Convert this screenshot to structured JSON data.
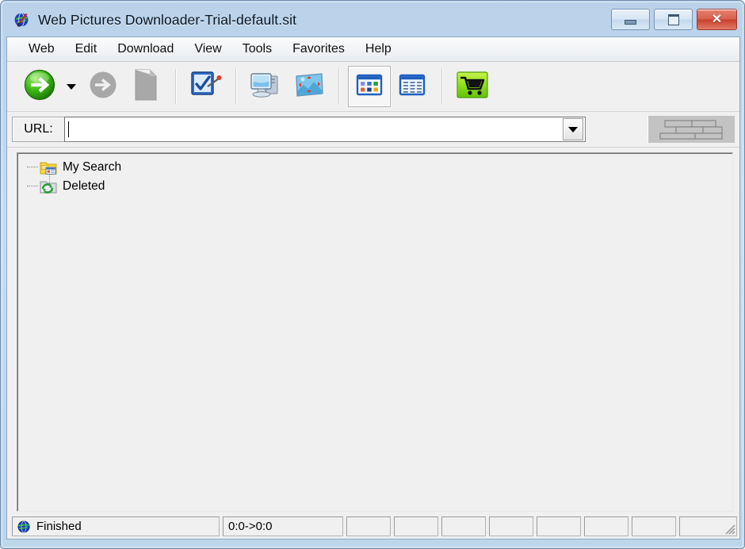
{
  "window": {
    "title": "Web Pictures Downloader-Trial-default.sit",
    "app_icon": "globe-app-icon",
    "controls": {
      "minimize": "minimize-button",
      "restore": "restore-button",
      "close_glyph": "✕"
    }
  },
  "menubar": {
    "items": [
      {
        "label": "Web"
      },
      {
        "label": "Edit"
      },
      {
        "label": "Download"
      },
      {
        "label": "View"
      },
      {
        "label": "Tools"
      },
      {
        "label": "Favorites"
      },
      {
        "label": "Help"
      }
    ]
  },
  "toolbar": {
    "buttons": [
      {
        "name": "start-download-button",
        "icon": "green-circle-arrow-icon",
        "enabled": true
      },
      {
        "name": "start-download-dropdown",
        "icon": "caret-down-icon",
        "enabled": true
      },
      {
        "name": "stop-download-button",
        "icon": "gray-circle-arrow-icon",
        "enabled": false
      },
      {
        "name": "new-page-button",
        "icon": "gray-page-icon",
        "enabled": false
      },
      {
        "name": "select-all-button",
        "icon": "blue-checkmark-icon",
        "enabled": true
      },
      {
        "name": "computer-button",
        "icon": "computer-monitor-icon",
        "enabled": true
      },
      {
        "name": "picture-properties-button",
        "icon": "picture-resize-icon",
        "enabled": true
      },
      {
        "name": "thumbnail-view-button",
        "icon": "thumbnail-grid-icon",
        "enabled": true,
        "pressed": true
      },
      {
        "name": "details-view-button",
        "icon": "details-list-icon",
        "enabled": true,
        "pressed": false
      },
      {
        "name": "buy-button",
        "icon": "shopping-cart-icon",
        "enabled": true
      }
    ]
  },
  "urlbar": {
    "label": "URL:",
    "value": "",
    "placeholder": "",
    "dropdown_icon": "caret-down-icon",
    "gripper": "brick-gripper-panel"
  },
  "tree": {
    "items": [
      {
        "label": "My Search",
        "icon": "search-folder-icon"
      },
      {
        "label": "Deleted",
        "icon": "recycle-folder-icon"
      }
    ]
  },
  "statusbar": {
    "status_icon": "globe-icon",
    "status_text": "Finished",
    "ratio_text": "0:0->0:0",
    "extra_panes": [
      "",
      "",
      "",
      "",
      "",
      "",
      "",
      ""
    ],
    "resize_grip": "resize-grip-icon"
  },
  "colors": {
    "frame_blue": "#bdd6ea",
    "client_gray": "#f0f0f0",
    "accent_green": "#22a722",
    "close_red": "#c8402c",
    "folder_yellow": "#f5d64a",
    "cart_green": "#8ede1e"
  }
}
